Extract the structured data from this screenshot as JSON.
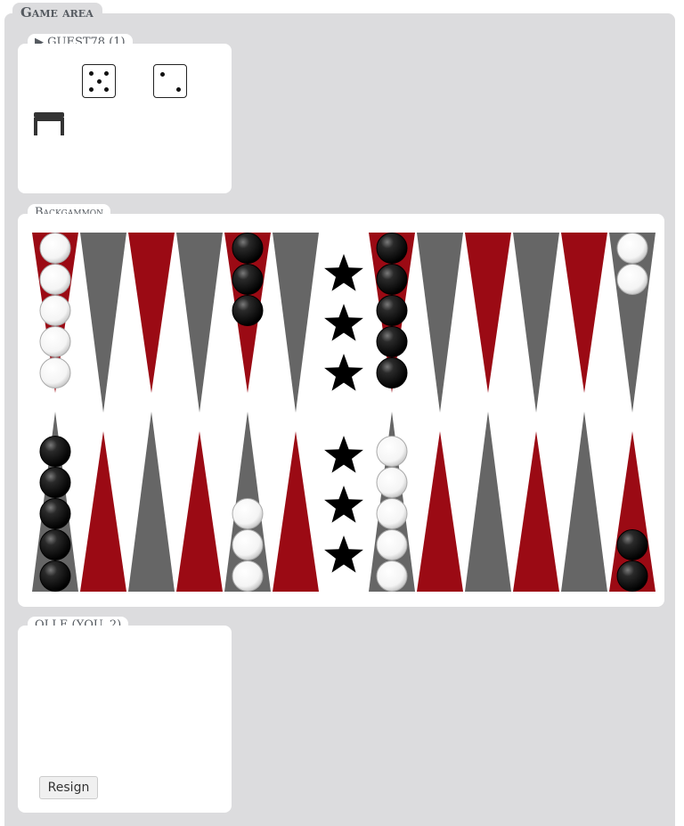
{
  "game_area": {
    "title": "Game area"
  },
  "top_player": {
    "label": "▶ GUEST78 (1)",
    "dice": [
      5,
      2
    ]
  },
  "board": {
    "title": "Backgammon",
    "colors": {
      "dark_point": "#9b0a14",
      "light_point": "#666666",
      "black_checker": "#111111",
      "white_checker": "#ffffff"
    },
    "stars": 6,
    "top_points": [
      {
        "color": "red",
        "checkers": "white",
        "count": 5
      },
      {
        "color": "gray",
        "checkers": null,
        "count": 0
      },
      {
        "color": "red",
        "checkers": null,
        "count": 0
      },
      {
        "color": "gray",
        "checkers": null,
        "count": 0
      },
      {
        "color": "red",
        "checkers": "black",
        "count": 3
      },
      {
        "color": "gray",
        "checkers": null,
        "count": 0
      },
      {
        "color": "red",
        "checkers": "black",
        "count": 5
      },
      {
        "color": "gray",
        "checkers": null,
        "count": 0
      },
      {
        "color": "red",
        "checkers": null,
        "count": 0
      },
      {
        "color": "gray",
        "checkers": null,
        "count": 0
      },
      {
        "color": "red",
        "checkers": null,
        "count": 0
      },
      {
        "color": "gray",
        "checkers": "white",
        "count": 2
      }
    ],
    "bottom_points": [
      {
        "color": "gray",
        "checkers": "black",
        "count": 5
      },
      {
        "color": "red",
        "checkers": null,
        "count": 0
      },
      {
        "color": "gray",
        "checkers": null,
        "count": 0
      },
      {
        "color": "red",
        "checkers": null,
        "count": 0
      },
      {
        "color": "gray",
        "checkers": "white",
        "count": 3
      },
      {
        "color": "red",
        "checkers": null,
        "count": 0
      },
      {
        "color": "gray",
        "checkers": "white",
        "count": 5
      },
      {
        "color": "red",
        "checkers": null,
        "count": 0
      },
      {
        "color": "gray",
        "checkers": null,
        "count": 0
      },
      {
        "color": "red",
        "checkers": null,
        "count": 0
      },
      {
        "color": "gray",
        "checkers": null,
        "count": 0
      },
      {
        "color": "red",
        "checkers": "black",
        "count": 2
      }
    ]
  },
  "bottom_player": {
    "label": "OLLE (YOU, 2)",
    "resign_label": "Resign"
  }
}
